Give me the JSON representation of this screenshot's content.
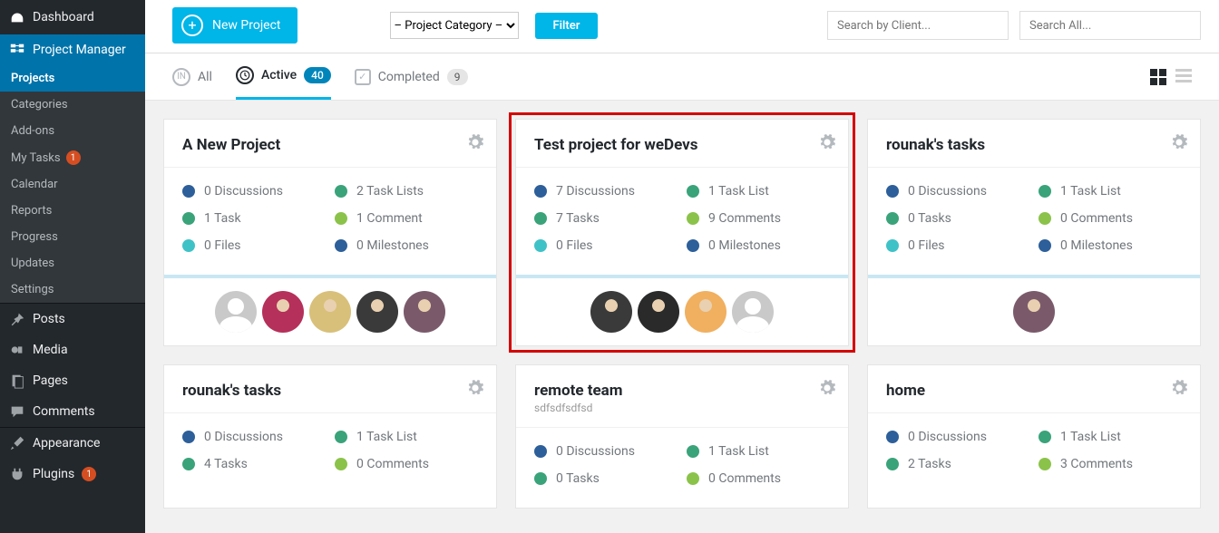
{
  "sidebar": {
    "dashboard": "Dashboard",
    "project_manager": "Project Manager",
    "sub": {
      "projects": "Projects",
      "categories": "Categories",
      "addons": "Add-ons",
      "my_tasks": "My Tasks",
      "my_tasks_badge": "1",
      "calendar": "Calendar",
      "reports": "Reports",
      "progress": "Progress",
      "updates": "Updates",
      "settings": "Settings"
    },
    "posts": "Posts",
    "media": "Media",
    "pages": "Pages",
    "comments": "Comments",
    "appearance": "Appearance",
    "plugins": "Plugins",
    "plugins_badge": "1"
  },
  "topbar": {
    "new_project": "New Project",
    "category_placeholder": "– Project Category –",
    "filter": "Filter",
    "search_client_ph": "Search by Client...",
    "search_all_ph": "Search All..."
  },
  "tabs": {
    "all": "All",
    "active": "Active",
    "active_count": "40",
    "completed": "Completed",
    "completed_count": "9"
  },
  "stat_colors": {
    "discussions": "#2d5f9a",
    "tasks": "#3aa37a",
    "files": "#3fc2c7",
    "tasklists": "#3aa37a",
    "comments": "#8bc34a",
    "milestones": "#2d5f9a"
  },
  "projects": [
    {
      "title": "A New Project",
      "subtitle": "",
      "highlight": false,
      "stats": {
        "discussions": "0 Discussions",
        "tasklists": "2 Task Lists",
        "tasks": "1 Task",
        "comments": "1 Comment",
        "files": "0 Files",
        "milestones": "0 Milestones"
      },
      "avatars": [
        "grey",
        "p1",
        "p2",
        "p3",
        "p4"
      ]
    },
    {
      "title": "Test project for weDevs",
      "subtitle": "",
      "highlight": true,
      "stats": {
        "discussions": "7 Discussions",
        "tasklists": "1 Task List",
        "tasks": "7 Tasks",
        "comments": "9 Comments",
        "files": "0 Files",
        "milestones": "0 Milestones"
      },
      "avatars": [
        "p3",
        "p3b",
        "p5",
        "grey"
      ]
    },
    {
      "title": "rounak's tasks",
      "subtitle": "",
      "highlight": false,
      "stats": {
        "discussions": "0 Discussions",
        "tasklists": "1 Task List",
        "tasks": "0 Tasks",
        "comments": "0 Comments",
        "files": "0 Files",
        "milestones": "0 Milestones"
      },
      "avatars": [
        "p4"
      ]
    },
    {
      "title": "rounak's tasks",
      "subtitle": "",
      "highlight": false,
      "stats": {
        "discussions": "0 Discussions",
        "tasklists": "1 Task List",
        "tasks": "4 Tasks",
        "comments": "0 Comments",
        "files": "",
        "milestones": ""
      },
      "avatars": []
    },
    {
      "title": "remote team",
      "subtitle": "sdfsdfsdfsd",
      "highlight": false,
      "stats": {
        "discussions": "0 Discussions",
        "tasklists": "1 Task List",
        "tasks": "0 Tasks",
        "comments": "0 Comments",
        "files": "",
        "milestones": ""
      },
      "avatars": []
    },
    {
      "title": "home",
      "subtitle": "",
      "highlight": false,
      "stats": {
        "discussions": "0 Discussions",
        "tasklists": "1 Task List",
        "tasks": "2 Tasks",
        "comments": "3 Comments",
        "files": "",
        "milestones": ""
      },
      "avatars": []
    }
  ],
  "avatar_colors": {
    "p1": "#b5305a",
    "p2": "#d8c07a",
    "p3": "#3a3a3a",
    "p3b": "#2a2a2a",
    "p4": "#7a5a6a",
    "p5": "#f0b060"
  }
}
